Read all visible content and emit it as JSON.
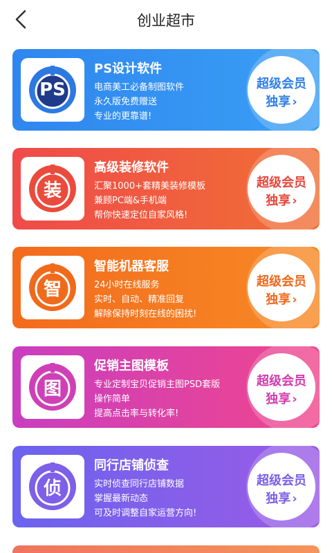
{
  "header": {
    "title": "创业超市",
    "back_icon": "chevron-left-icon"
  },
  "cards": [
    {
      "id": "ps",
      "icon_text": "PS",
      "name": "PS设计软件",
      "lines": [
        "电商美工必备制图软件",
        "永久版免费赠送",
        "专业的更靠谱!"
      ],
      "badge_line1": "超级会员",
      "badge_line2": "独享",
      "accent": "#2f7fe9"
    },
    {
      "id": "decorate",
      "icon_text": "装",
      "name": "高级装修软件",
      "lines": [
        "汇聚1000+套精美装修模板",
        "兼顾PC端&手机端",
        "帮你快速定位自家风格!"
      ],
      "badge_line1": "超级会员",
      "badge_line2": "独享",
      "accent": "#e8453a"
    },
    {
      "id": "robot",
      "icon_text": "智",
      "name": "智能机器客服",
      "lines": [
        "24小时在线服务",
        "实时、自动、精准回复",
        "解除保持时刻在线的困扰!"
      ],
      "badge_line1": "超级会员",
      "badge_line2": "独享",
      "accent": "#f0681a"
    },
    {
      "id": "template",
      "icon_text": "图",
      "name": "促销主图模板",
      "lines": [
        "专业定制宝贝促销主图PSD套版",
        "操作简单",
        "提高点击率与转化率!"
      ],
      "badge_line1": "超级会员",
      "badge_line2": "独享",
      "accent": "#d33bb0"
    },
    {
      "id": "spy",
      "icon_text": "侦",
      "name": "同行店铺侦查",
      "lines": [
        "实时侦查同行店铺数据",
        "掌握最新动态",
        "可及时调整自家运营方向!"
      ],
      "badge_line1": "超级会员",
      "badge_line2": "独享",
      "accent": "#7b5fe8"
    }
  ]
}
